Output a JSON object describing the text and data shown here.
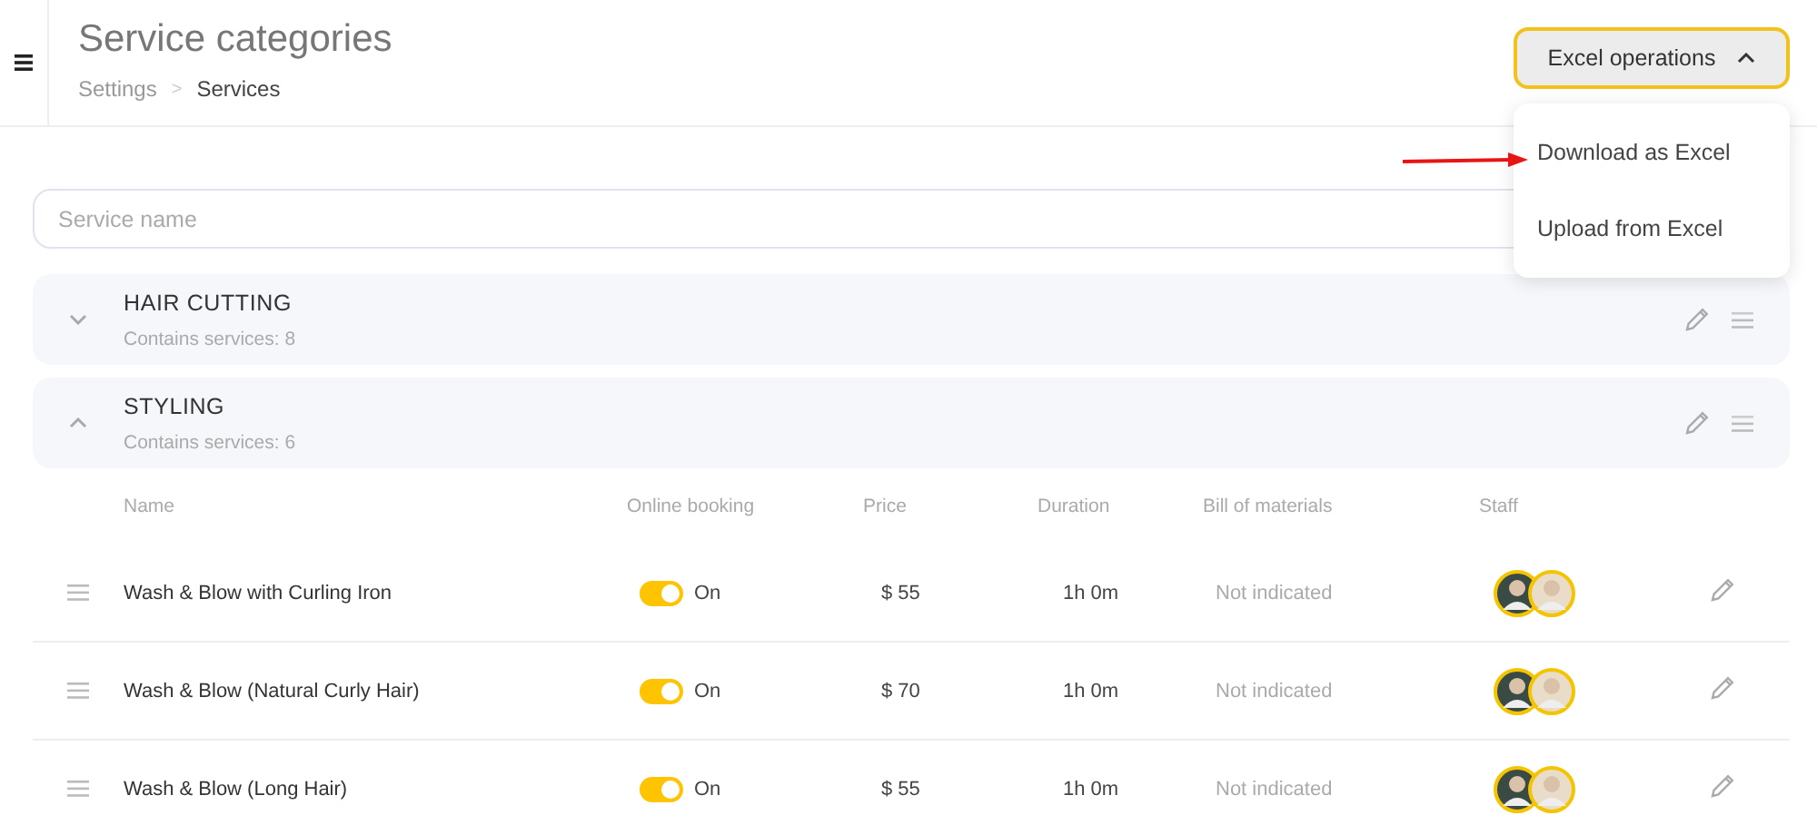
{
  "header": {
    "title": "Service categories",
    "breadcrumb": [
      {
        "label": "Settings",
        "current": false
      },
      {
        "label": "Services",
        "current": true
      }
    ],
    "separator": ">"
  },
  "excel_menu": {
    "label": "Excel operations",
    "expanded": true,
    "items": [
      {
        "label": "Download as Excel"
      },
      {
        "label": "Upload from Excel"
      }
    ]
  },
  "search": {
    "placeholder": "Service name"
  },
  "categories": [
    {
      "name": "HAIR CUTTING",
      "count_text": "Contains services: 8",
      "expanded": false
    },
    {
      "name": "STYLING",
      "count_text": "Contains services: 6",
      "expanded": true,
      "columns": [
        "Name",
        "Online booking",
        "Price",
        "Duration",
        "Bill of materials",
        "Staff"
      ],
      "services": [
        {
          "name": "Wash & Blow with Curling Iron",
          "online_booking": {
            "on": true,
            "label": "On"
          },
          "price": "$ 55",
          "duration": "1h 0m",
          "materials": "Not indicated",
          "staff": [
            {
              "kind": "avatar"
            },
            {
              "kind": "avatar"
            }
          ]
        },
        {
          "name": "Wash & Blow (Natural Curly Hair)",
          "online_booking": {
            "on": true,
            "label": "On"
          },
          "price": "$ 70",
          "duration": "1h 0m",
          "materials": "Not indicated",
          "staff": [
            {
              "kind": "avatar"
            },
            {
              "kind": "avatar"
            }
          ]
        },
        {
          "name": "Wash & Blow (Long Hair)",
          "online_booking": {
            "on": true,
            "label": "On"
          },
          "price": "$ 55",
          "duration": "1h 0m",
          "materials": "Not indicated",
          "staff": [
            {
              "kind": "avatar"
            },
            {
              "kind": "avatar"
            }
          ]
        }
      ]
    }
  ]
}
